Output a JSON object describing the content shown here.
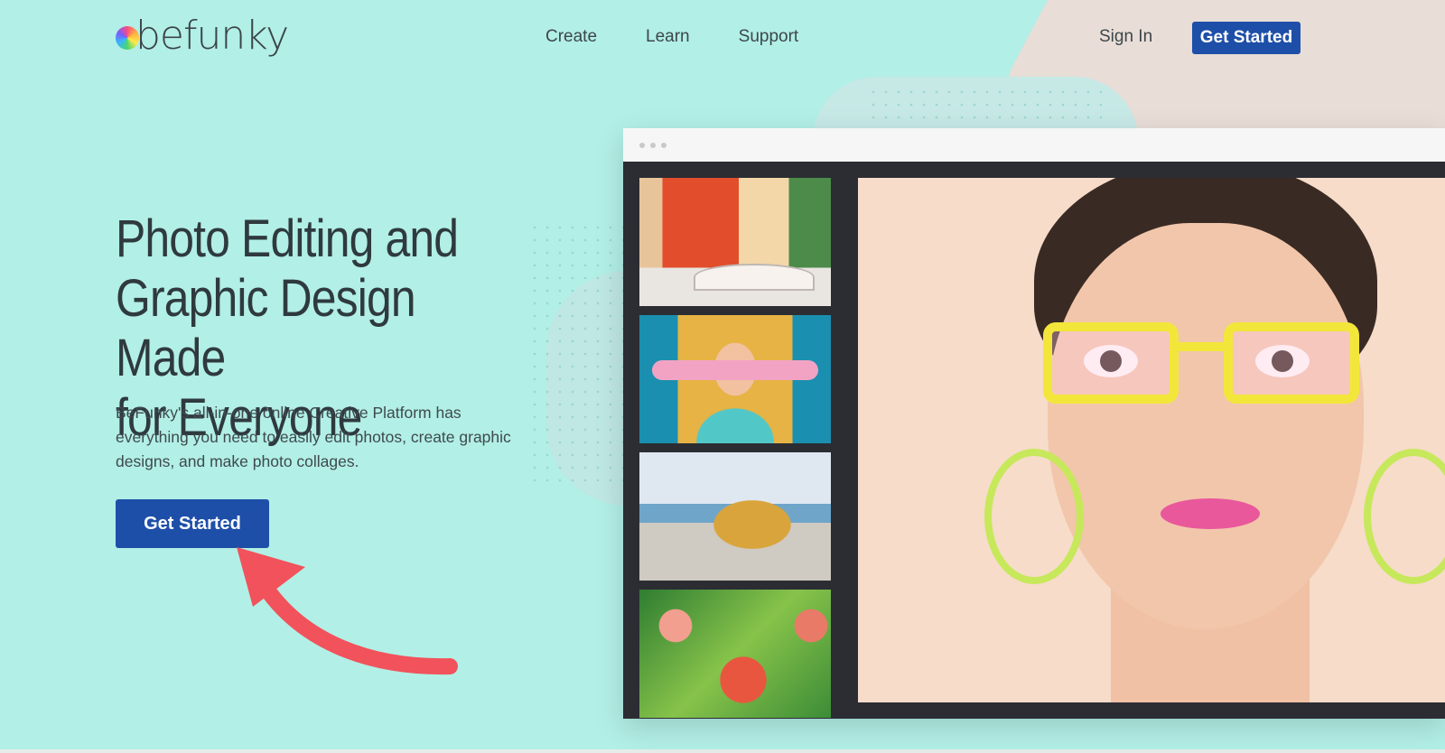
{
  "header": {
    "logo_text": "befunky",
    "nav": [
      {
        "label": "Create"
      },
      {
        "label": "Learn"
      },
      {
        "label": "Support"
      }
    ],
    "sign_in_label": "Sign In",
    "cta_label": "Get Started"
  },
  "hero": {
    "title_lines": [
      "Photo Editing and",
      "Graphic Design Made",
      "for Everyone"
    ],
    "description": "BeFunky's all-in-one online Creative Platform has everything you need to easily edit photos, create graphic designs, and make photo collages.",
    "cta_label": "Get Started"
  },
  "mockup": {
    "thumbnails": [
      {
        "icon": "venice-street-photo"
      },
      {
        "icon": "woman-skateboard-photo"
      },
      {
        "icon": "yellow-van-beach-photo"
      },
      {
        "icon": "apple-tree-photo"
      }
    ],
    "main_image": "cartoonized-woman-portrait"
  },
  "colors": {
    "background": "#b2efe6",
    "primary_button": "#1e4fa8",
    "annotation_arrow": "#f1525b"
  }
}
